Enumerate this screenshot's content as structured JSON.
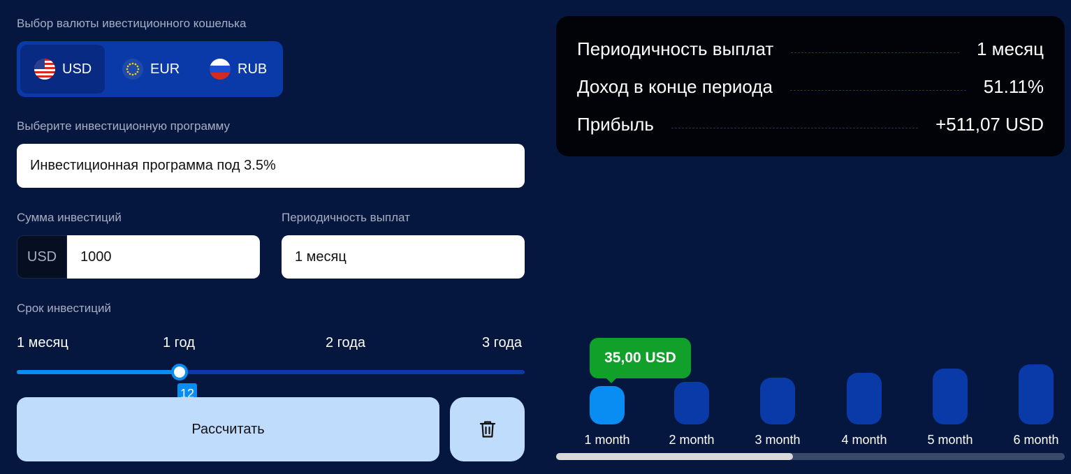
{
  "wallet": {
    "label": "Выбор валюты ивестиционного кошелька",
    "currencies": [
      {
        "code": "USD",
        "flag_icon": "us-flag-icon",
        "selected": true
      },
      {
        "code": "EUR",
        "flag_icon": "eu-flag-icon",
        "selected": false
      },
      {
        "code": "RUB",
        "flag_icon": "ru-flag-icon",
        "selected": false
      }
    ]
  },
  "program": {
    "label": "Выберите инвестиционную программу",
    "value": "Инвестиционная программа под 3.5%"
  },
  "amount": {
    "label": "Сумма инвестиций",
    "prefix": "USD",
    "value": "1000"
  },
  "frequency": {
    "label": "Периодичность выплат",
    "value": "1 месяц"
  },
  "term": {
    "label": "Срок инвестиций",
    "ticks": [
      "1 месяц",
      "1 год",
      "2 года",
      "3 года"
    ],
    "value": 12,
    "min": 1,
    "max": 36,
    "badge": "12"
  },
  "actions": {
    "calculate_label": "Рассчитать",
    "delete_icon": "trash-icon"
  },
  "summary": {
    "rows": [
      {
        "label": "Периодичность выплат",
        "value": "1 месяц"
      },
      {
        "label": "Доход в конце периода",
        "value": "51.11%"
      },
      {
        "label": "Прибыль",
        "value": "+511,07 USD"
      }
    ]
  },
  "payouts": {
    "tooltip": "35,00 USD",
    "bars": [
      {
        "label": "1 month",
        "active": true
      },
      {
        "label": "2 month",
        "active": false
      },
      {
        "label": "3 month",
        "active": false
      },
      {
        "label": "4 month",
        "active": false
      },
      {
        "label": "5 month",
        "active": false
      },
      {
        "label": "6 month",
        "active": false
      }
    ],
    "scroll_fraction": 0.466
  },
  "colors": {
    "background": "#05163f",
    "accent": "#0a8df2",
    "inactive": "#0a3aa8",
    "positive": "#11a12a",
    "button": "#bfdcfd"
  }
}
